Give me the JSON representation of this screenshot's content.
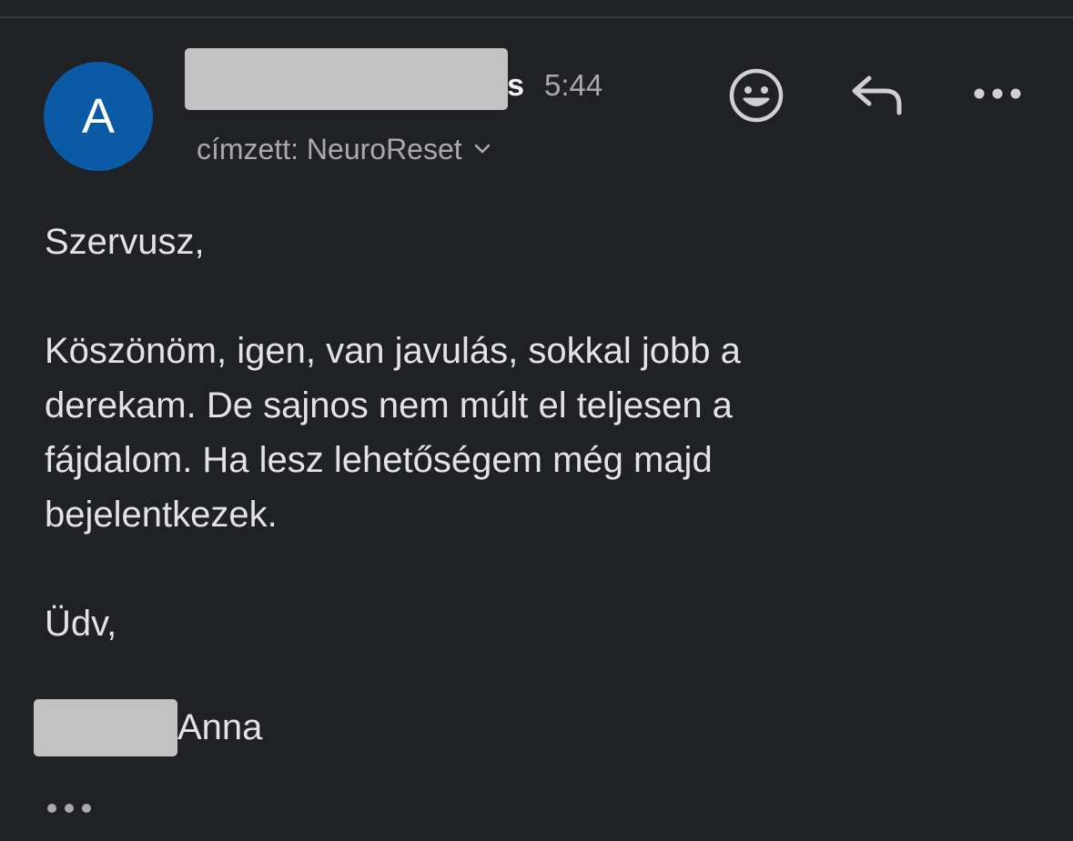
{
  "header": {
    "avatar_initial": "A",
    "sender_name_visible": "s",
    "time": "5:44",
    "recipient_label": "címzett: NeuroReset"
  },
  "icons": {
    "emoji": "smiley-face-icon",
    "reply": "reply-arrow-icon",
    "more": "more-dots-icon",
    "chevron": "chevron-down-icon",
    "trimmed": "show-trimmed-dots-icon"
  },
  "message": {
    "greeting": "Szervusz,",
    "paragraph_lines": [
      "Köszönöm, igen, van javulás, sokkal jobb a",
      "derekam. De sajnos nem múlt el teljesen a",
      "fájdalom. Ha lesz lehetőségem még majd",
      "bejelentkezek."
    ],
    "closing": "Üdv,",
    "signature_visible": "Anna"
  },
  "colors": {
    "background": "#202124",
    "avatar": "#0b5aa6",
    "text": "#e3e3e6",
    "secondary_text": "#a9a9ae",
    "redaction": "#c2c2c2"
  }
}
